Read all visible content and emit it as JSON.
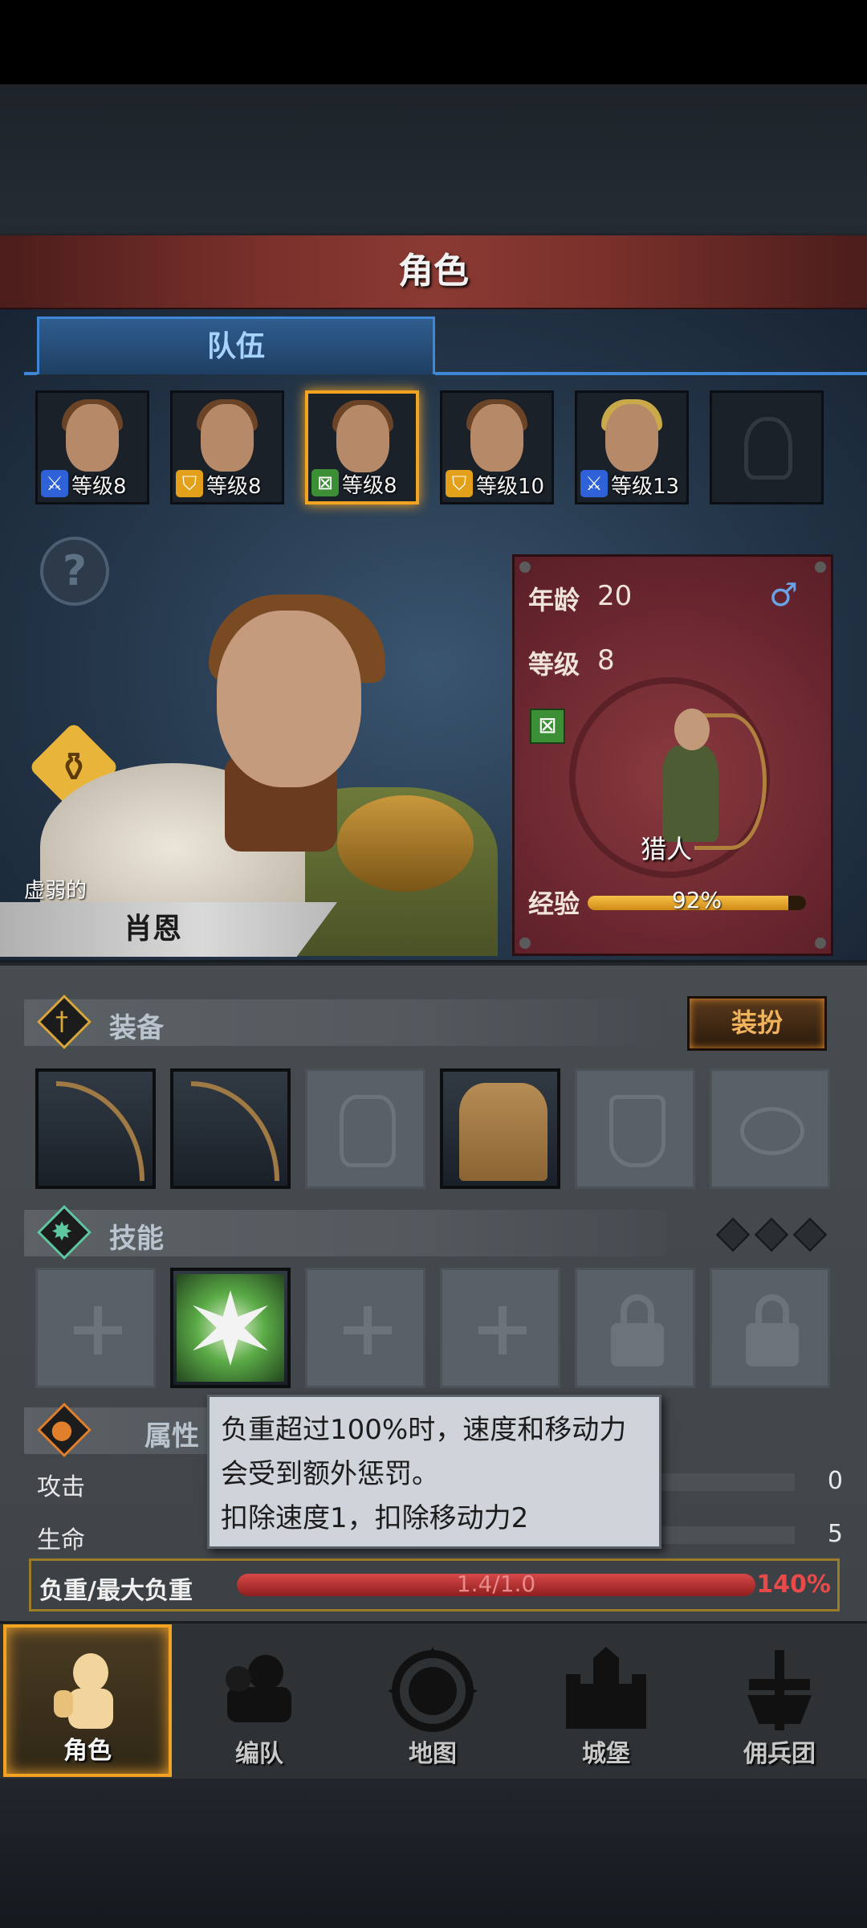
{
  "header": {
    "title": "角色"
  },
  "tabs": {
    "team_label": "队伍"
  },
  "team": [
    {
      "level_label": "等级8",
      "class_icon": "sword-icon",
      "hair": "brown"
    },
    {
      "level_label": "等级8",
      "class_icon": "shield-icon",
      "hair": "brown"
    },
    {
      "level_label": "等级8",
      "class_icon": "bow-icon",
      "hair": "brown",
      "selected": true
    },
    {
      "level_label": "等级10",
      "class_icon": "shield-icon",
      "hair": "brown"
    },
    {
      "level_label": "等级13",
      "class_icon": "sword-icon",
      "hair": "blond"
    },
    {
      "empty": true
    }
  ],
  "hero": {
    "status": "虚弱的",
    "name": "肖恩"
  },
  "stats_card": {
    "age_label": "年龄",
    "age": "20",
    "gender_symbol": "♂",
    "level_label": "等级",
    "level": "8",
    "class_name": "猎人",
    "xp_label": "经验",
    "xp_text": "92%",
    "xp_fraction": 0.92
  },
  "equipment": {
    "title": "装备",
    "dress_button": "装扮",
    "slots": [
      "bow",
      "bow",
      "helmet-empty",
      "shirt",
      "boots-empty",
      "ring-empty"
    ]
  },
  "skills": {
    "title": "技能",
    "slots": [
      "empty",
      "skill",
      "empty",
      "empty",
      "locked",
      "locked"
    ]
  },
  "attributes": {
    "title": "属性",
    "rows": [
      {
        "label": "攻击",
        "value": "0"
      },
      {
        "label": "生命",
        "value": "5"
      }
    ],
    "load": {
      "label": "负重/最大负重",
      "bar_text": "1.4/1.0",
      "percent": "140%",
      "fraction": 1.0
    }
  },
  "tooltip": {
    "line1": "负重超过100%时，速度和移动力",
    "line2": "会受到额外惩罚。",
    "line3": "扣除速度1，扣除移动力2"
  },
  "nav": [
    {
      "label": "角色",
      "icon": "knight-icon",
      "active": true
    },
    {
      "label": "编队",
      "icon": "formation-icon"
    },
    {
      "label": "地图",
      "icon": "compass-icon"
    },
    {
      "label": "城堡",
      "icon": "castle-icon"
    },
    {
      "label": "佣兵团",
      "icon": "mercenary-icon"
    }
  ],
  "colors": {
    "accent_gold": "#f2a322",
    "tab_blue": "#3f87d4",
    "header_red": "#7a302b"
  }
}
